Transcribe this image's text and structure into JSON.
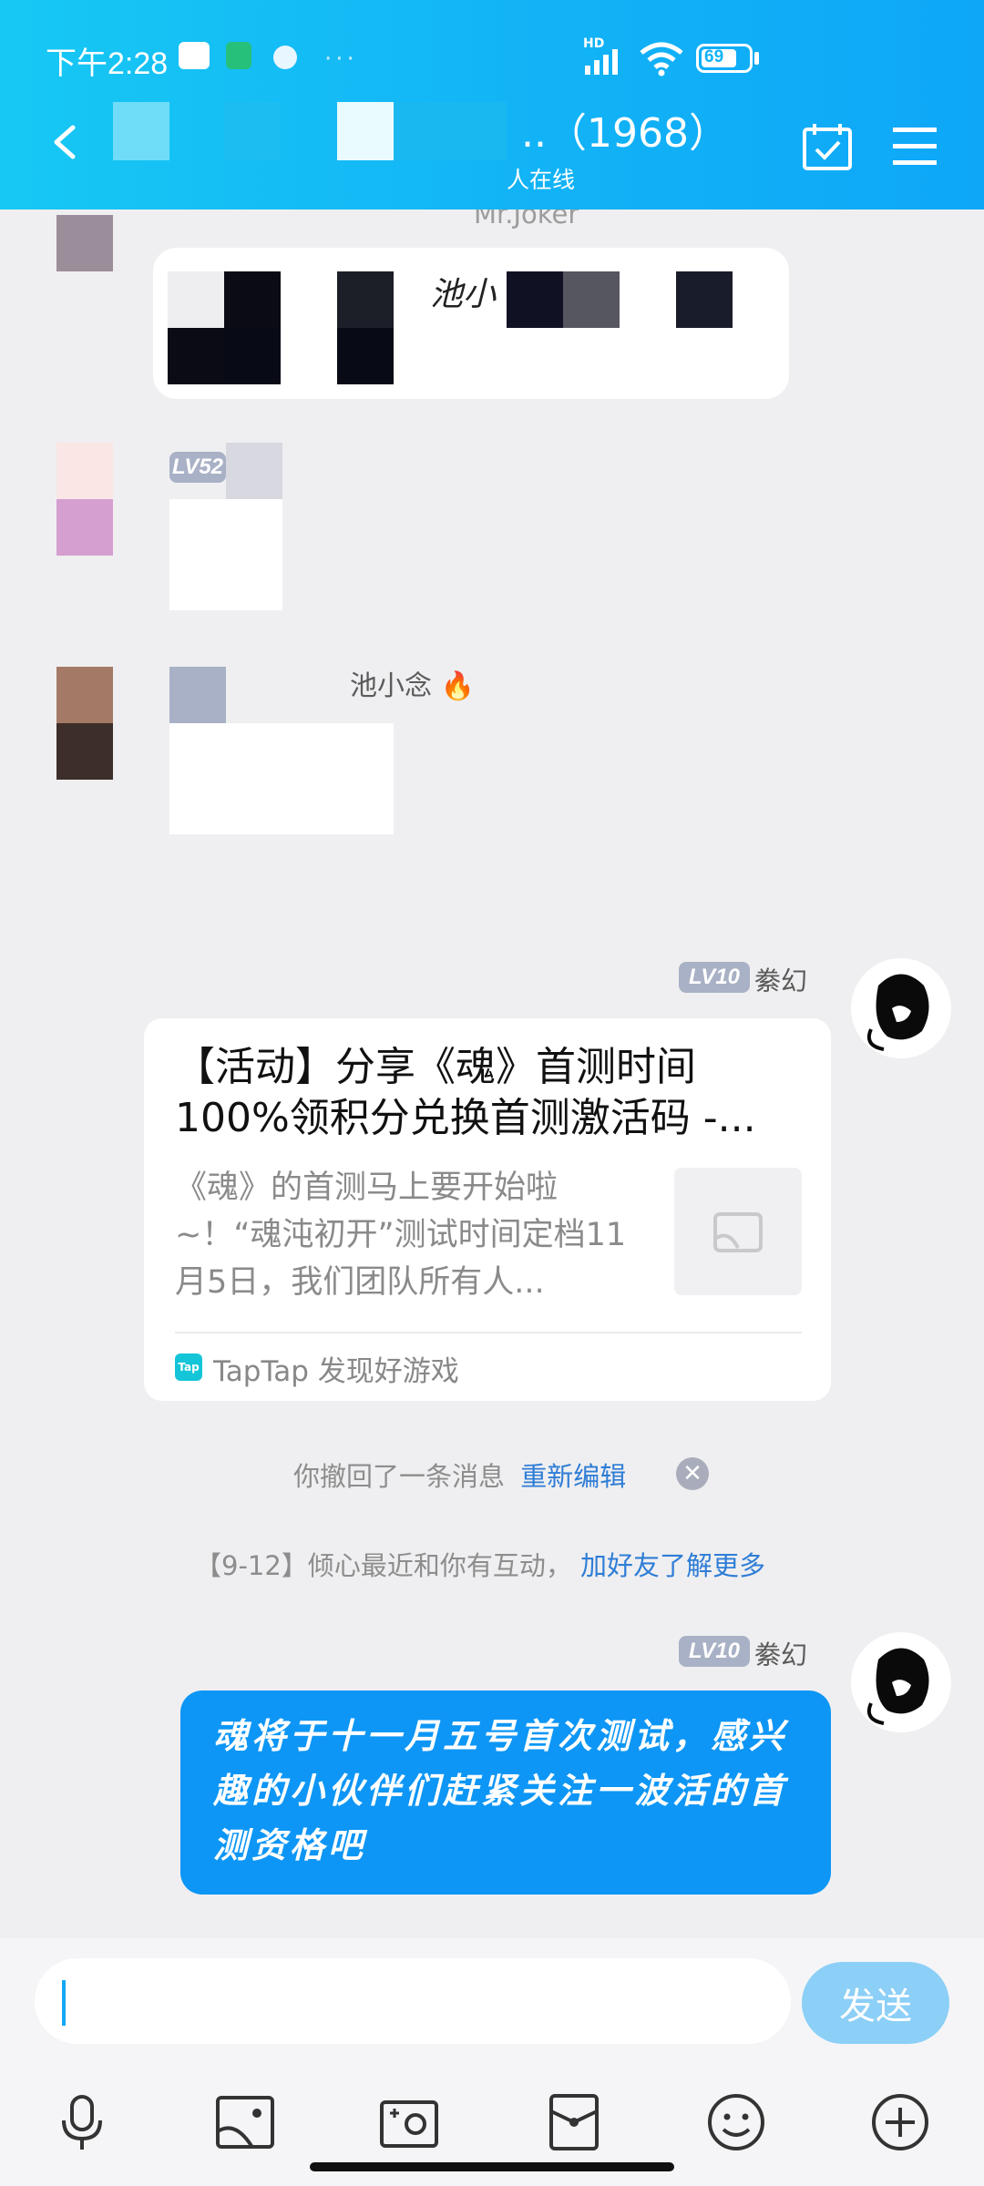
{
  "status_bar": {
    "time": "下午2:28",
    "network_label": "HD",
    "battery": "69"
  },
  "header": {
    "title_suffix": "..（1968）",
    "subtitle": "人在线"
  },
  "messages": {
    "m1_nick": "Mr.Joker",
    "m1_text_fragment": "池小",
    "m2_level": "LV52",
    "m3_nick": "池小念",
    "m3_emoji": "🔥",
    "m4_level": "LV10",
    "m4_nick": "絭幻",
    "card_title": "【活动】分享《魂》首测时间100%领积分兑换首测激活码 -...",
    "card_desc": "《魂》的首测马上要开始啦~！“魂沌初开”测试时间定档11月5日，我们团队所有人...",
    "card_source_icon": "Tap",
    "card_source": "TapTap 发现好游戏",
    "sys_recall": "你撤回了一条消息",
    "sys_reedit": "重新编辑",
    "sys_interact": "【9-12】倾心最近和你有互动，",
    "sys_interact_link": "加好友了解更多",
    "m5_level": "LV10",
    "m5_nick": "絭幻",
    "m5_text": "魂将于十一月五号首次测试，感兴趣的小伙伴们赶紧关注一波活的首测资格吧"
  },
  "input": {
    "value": "",
    "send_label": "发送"
  },
  "toolbar_icons": [
    "microphone-icon",
    "image-icon",
    "camera-icon",
    "red-packet-icon",
    "emoji-icon",
    "plus-icon"
  ],
  "colors": {
    "header": "#12b3f6",
    "bubble_blue": "#0d96f5",
    "send_button": "#8ccff7",
    "link": "#2f7dd6"
  }
}
